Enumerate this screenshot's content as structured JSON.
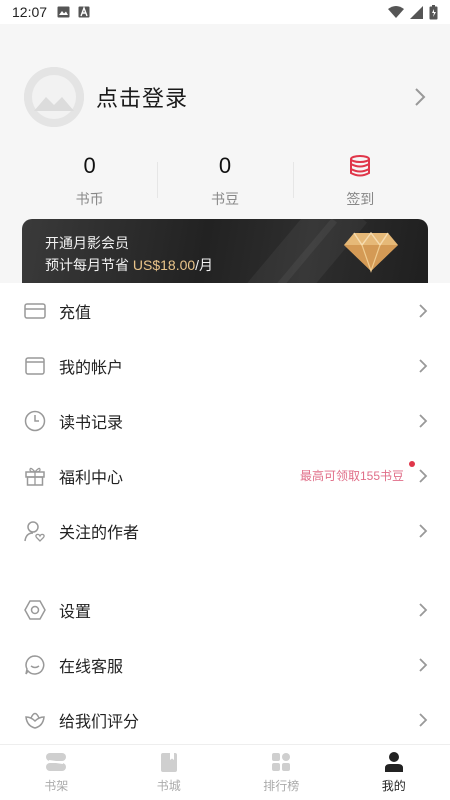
{
  "status_bar": {
    "time": "12:07",
    "icons": [
      "image-icon",
      "a-letter-icon",
      "wifi-icon",
      "signal-icon",
      "battery-icon"
    ]
  },
  "profile": {
    "login_text": "点击登录",
    "avatar_icon": "mountain-placeholder-icon"
  },
  "stats": [
    {
      "value": "0",
      "label": "书币"
    },
    {
      "value": "0",
      "label": "书豆"
    },
    {
      "icon": "coin-stack-icon",
      "label": "签到"
    }
  ],
  "vip_banner": {
    "title": "开通月影会员",
    "sub_prefix": "预计每月节省 ",
    "price": "US$18.00",
    "sub_suffix": "/月",
    "icon": "diamond-icon"
  },
  "menu": {
    "items": [
      {
        "label": "充值",
        "icon": "card-icon"
      },
      {
        "label": "我的帐户",
        "icon": "wallet-icon"
      },
      {
        "label": "读书记录",
        "icon": "clock-icon"
      },
      {
        "label": "福利中心",
        "icon": "gift-icon",
        "extra": "最高可领取155书豆"
      },
      {
        "label": "关注的作者",
        "icon": "user-heart-icon"
      },
      {
        "label": "设置",
        "icon": "settings-icon"
      },
      {
        "label": "在线客服",
        "icon": "chat-icon"
      },
      {
        "label": "给我们评分",
        "icon": "flower-icon"
      }
    ]
  },
  "tabs": [
    {
      "label": "书架",
      "icon": "bookshelf-icon",
      "active": false
    },
    {
      "label": "书城",
      "icon": "book-icon",
      "active": false
    },
    {
      "label": "排行榜",
      "icon": "grid-icon",
      "active": false
    },
    {
      "label": "我的",
      "icon": "person-icon",
      "active": true
    }
  ],
  "colors": {
    "accent": "#e0364a",
    "highlight_text": "#e06e88",
    "vip_price": "#e9c48a",
    "header_bg": "#f6f6f6"
  }
}
